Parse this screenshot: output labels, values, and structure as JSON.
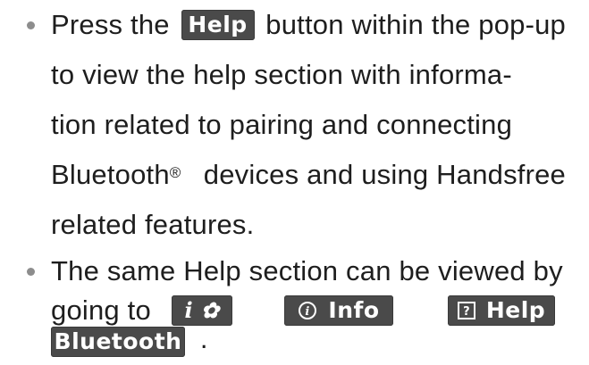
{
  "bullets": [
    {
      "lines": [
        {
          "before": "Press the",
          "button": "Help",
          "after": "button within the pop-up"
        },
        {
          "text": "to view the help section with informa-"
        },
        {
          "text": "tion related to pairing and connecting"
        },
        {
          "text_a": "Bluetooth",
          "sup": "®",
          "text_b": "devices and using Handsfree"
        },
        {
          "text": "related features."
        }
      ]
    },
    {
      "lines": [
        {
          "text": "The same Help section can be viewed by"
        },
        {
          "before": "going to",
          "btn_setup_icons": "i ✿",
          "btn_info": "Info",
          "btn_help": "Help"
        },
        {
          "btn_bluetooth": "Bluetooth",
          "after": "."
        }
      ]
    }
  ],
  "icons": {
    "info_icon": "info-circle-icon",
    "help_icon": "question-box-icon",
    "setup_icon": "gear-icon"
  },
  "colors": {
    "button_bg": "#4a4a4a",
    "button_text": "#ffffff",
    "bullet": "#8d8d8d",
    "body_text": "#1e1e1e"
  }
}
